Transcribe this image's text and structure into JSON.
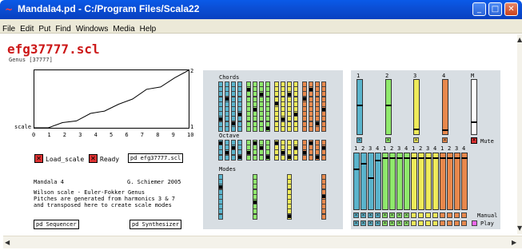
{
  "window": {
    "title": "Mandala4.pd  - C:/Program Files/Scala22",
    "icon": "pd-icon"
  },
  "menu": [
    "File",
    "Edit",
    "Put",
    "Find",
    "Windows",
    "Media",
    "Help"
  ],
  "scale": {
    "title": "efg37777.scl",
    "genus": "Genus [37777]"
  },
  "plot": {
    "ylabel": "scale",
    "ymax": "2",
    "ymin": "1",
    "xticks": [
      "0",
      "1",
      "2",
      "3",
      "4",
      "5",
      "6",
      "7",
      "8",
      "9",
      "10"
    ],
    "values": [
      1.0,
      1.0,
      1.09,
      1.12,
      1.25,
      1.29,
      1.41,
      1.5,
      1.67,
      1.71,
      1.87,
      2.0
    ]
  },
  "controls": {
    "load_label": "Load_scale",
    "ready_label": "Ready",
    "scl_object": "pd efg37777.scl"
  },
  "info": {
    "left": "Mandala 4",
    "right": "G. Schiemer 2005",
    "lines": [
      "Wilson scale - Euler-Fokker Genus",
      "Pitches are generated from harmonics 3 & 7",
      "and transposed here to create scale modes"
    ]
  },
  "buttons": {
    "sequencer": "pd Sequencer",
    "synthesizer": "pd Synthesizer"
  },
  "panels": {
    "chords": "Chords",
    "octave": "Octave",
    "modes": "Modes",
    "mute": "Mute",
    "manual": "Manual",
    "play": "Play"
  },
  "voices": {
    "labels": [
      "1",
      "2",
      "3",
      "4",
      "M"
    ],
    "levels": [
      0.55,
      0.55,
      0.12,
      0.1,
      0.25
    ]
  },
  "sublabels": [
    "1",
    "2",
    "3",
    "4"
  ],
  "colors": {
    "blue": "#5ab4cc",
    "green": "#8fe86c",
    "yellow": "#eeea5a",
    "orange": "#e8884c",
    "white": "#ffffff",
    "red": "#d33333",
    "magenta": "#ee66ee"
  }
}
